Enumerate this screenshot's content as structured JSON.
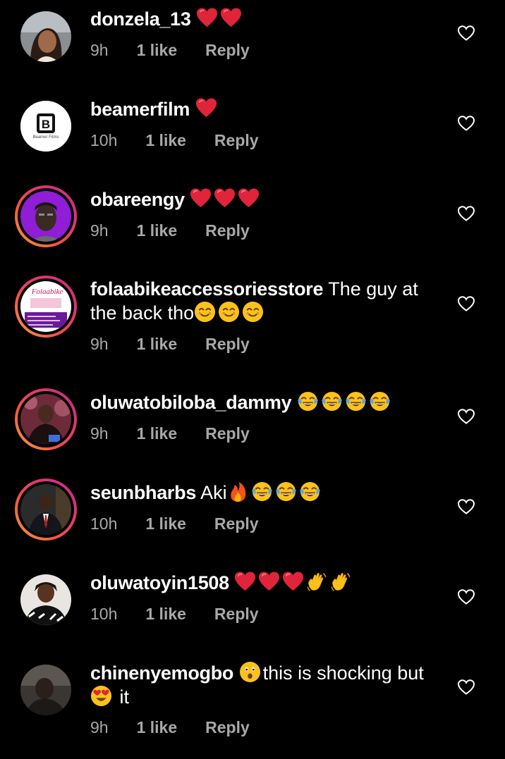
{
  "comments": [
    {
      "username": "donzela_13",
      "text": "",
      "time": "9h",
      "likes": "1 like",
      "reply": "Reply",
      "emojis": [
        "red-heart",
        "red-heart"
      ]
    },
    {
      "username": "beamerfilm",
      "text": "",
      "time": "10h",
      "likes": "1 like",
      "reply": "Reply",
      "emojis": [
        "red-heart"
      ],
      "avatar_text": "B",
      "avatar_subtext": "Beamer Films"
    },
    {
      "username": "obareengy",
      "text": "",
      "time": "9h",
      "likes": "1 like",
      "reply": "Reply",
      "emojis": [
        "red-heart",
        "red-heart",
        "red-heart"
      ]
    },
    {
      "username": "folaabikeaccessoriesstore",
      "text": "The guy at the back tho",
      "time": "9h",
      "likes": "1 like",
      "reply": "Reply",
      "emojis": [
        "smiling-face",
        "smiling-face",
        "smiling-face"
      ],
      "avatar_text": "Folaabike"
    },
    {
      "username": "oluwatobiloba_dammy",
      "text": "",
      "time": "9h",
      "likes": "1 like",
      "reply": "Reply",
      "emojis": [
        "tears-of-joy",
        "tears-of-joy",
        "tears-of-joy",
        "tears-of-joy"
      ]
    },
    {
      "username": "seunbharbs",
      "text": "Aki",
      "time": "10h",
      "likes": "1 like",
      "reply": "Reply",
      "emojis": [
        "fire",
        "tears-of-joy",
        "tears-of-joy",
        "tears-of-joy"
      ]
    },
    {
      "username": "oluwatoyin1508",
      "text": "",
      "time": "10h",
      "likes": "1 like",
      "reply": "Reply",
      "emojis": [
        "red-heart",
        "red-heart",
        "red-heart",
        "waving-hand",
        "waving-hand"
      ]
    },
    {
      "username": "chinenyemogbo",
      "text": "this is shocking but",
      "text2": "it",
      "time": "9h",
      "likes": "1 like",
      "reply": "Reply",
      "emojis": [
        "astonished-face"
      ],
      "emojis2": [
        "heart-eyes-face"
      ]
    }
  ],
  "colors": {
    "background": "#000000",
    "text": "#ffffff",
    "meta": "#a8a8a8",
    "heart": "#e0243a",
    "emoji_yellow": "#fcc21b"
  }
}
